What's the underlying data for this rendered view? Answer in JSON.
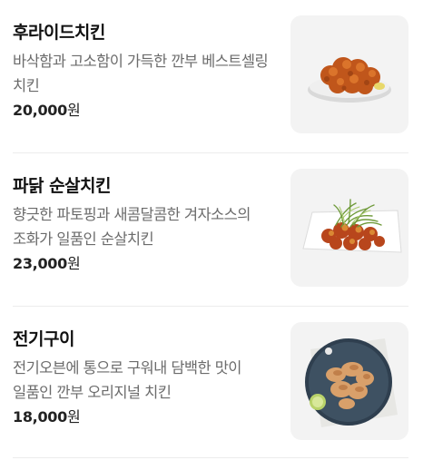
{
  "menu": {
    "items": [
      {
        "name": "후라이드치킨",
        "desc": "바삭함과 고소함이 가득한 깐부 베스트셀링 치킨",
        "price": "20,000",
        "unit": "원",
        "photo_icon": "fried-chicken-photo"
      },
      {
        "name": "파닭 순살치킨",
        "desc": "향긋한 파토핑과 새콤달콤한 겨자소스의 조화가 일품인 순살치킨",
        "price": "23,000",
        "unit": "원",
        "photo_icon": "scallion-boneless-chicken-photo"
      },
      {
        "name": "전기구이",
        "desc": "전기오븐에 통으로 구워내 담백한 맛이 일품인 깐부 오리지널 치킨",
        "price": "18,000",
        "unit": "원",
        "photo_icon": "rotisserie-chicken-photo"
      }
    ]
  },
  "colors": {
    "text_primary": "#111111",
    "text_secondary": "#6b6b6b",
    "divider": "#ececec",
    "photo_bg": "#f3f3f3"
  }
}
